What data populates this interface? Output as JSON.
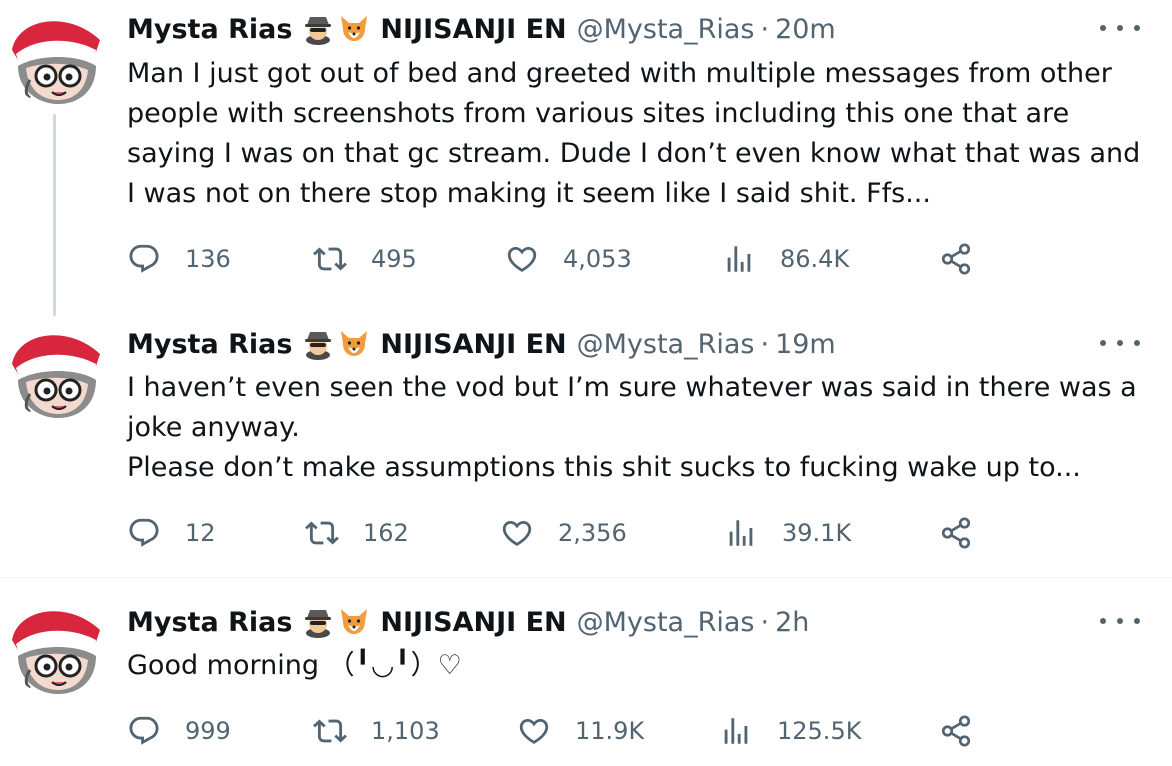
{
  "author": {
    "name": "Mysta Rias",
    "affiliation": "NIJISANJI EN",
    "handle": "@Mysta_Rias",
    "badges": [
      "detective-emoji-icon",
      "fox-emoji-icon"
    ]
  },
  "tweets": [
    {
      "time": "20m",
      "text_lines": [
        "Man I just got out of bed and greeted with multiple messages from other",
        "people with screenshots from various sites including this one that are",
        "saying I was on that gc stream. Dude I don’t even know what that was and",
        "I was not on there stop making it seem like I said shit. Ffs..."
      ],
      "replies": "136",
      "retweets": "495",
      "likes": "4,053",
      "views": "86.4K"
    },
    {
      "time": "19m",
      "text_lines": [
        "I haven’t even seen the vod but I’m sure whatever was said in there was a",
        "joke anyway.",
        "Please don’t make assumptions this shit sucks to fucking wake up to..."
      ],
      "replies": "12",
      "retweets": "162",
      "likes": "2,356",
      "views": "39.1K"
    },
    {
      "time": "2h",
      "text_lines": [
        "Good morning （╹◡╹）♡"
      ],
      "replies": "999",
      "retweets": "1,103",
      "likes": "11.9K",
      "views": "125.5K"
    }
  ],
  "colors": {
    "text": "#0f1419",
    "secondary": "#536471",
    "thread_line": "#cfd9de",
    "divider": "#eff3f4"
  }
}
